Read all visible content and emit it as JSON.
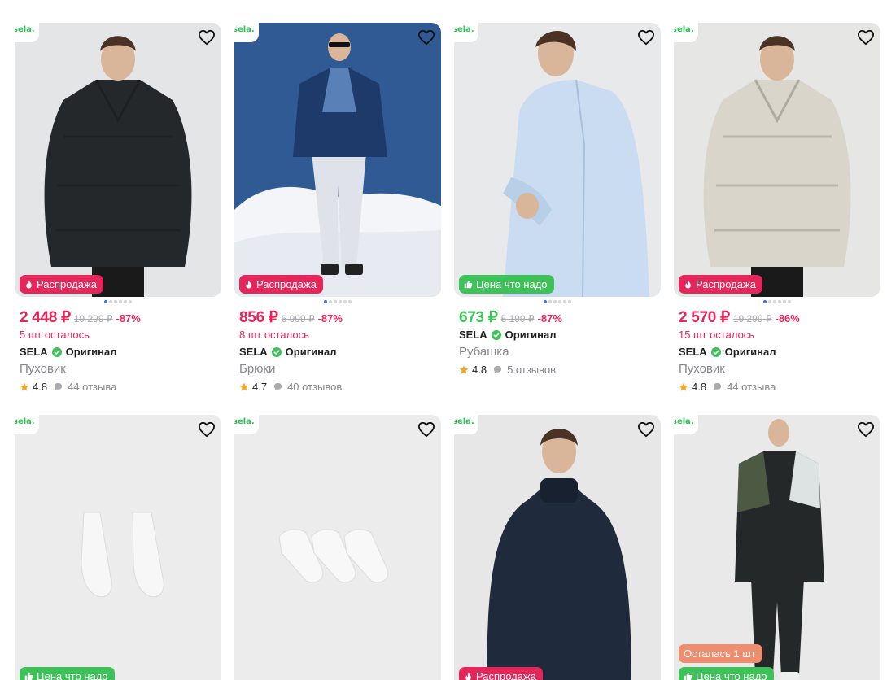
{
  "products": [
    {
      "brand_logo": "sela.",
      "badge": {
        "type": "sale",
        "text": "Распродажа",
        "icon": "flame-icon"
      },
      "price_now": "2 448 ₽",
      "price_old": "19 299 ₽",
      "discount": "-87%",
      "stock": "5 шт осталось",
      "seller": "SELA",
      "verified": "Оригинал",
      "title": "Пуховик",
      "rating": "4.8",
      "reviews": "44 отзыва",
      "photo": {
        "bg": "#e4e5e7",
        "garment": "#25282b",
        "type": "jacket"
      }
    },
    {
      "brand_logo": "sela.",
      "badge": {
        "type": "sale",
        "text": "Распродажа",
        "icon": "flame-icon"
      },
      "price_now": "856 ₽",
      "price_old": "6 999 ₽",
      "discount": "-87%",
      "stock": "8 шт осталось",
      "seller": "SELA",
      "verified": "Оригинал",
      "title": "Брюки",
      "rating": "4.7",
      "reviews": "40 отзывов",
      "photo": {
        "bg": "#2f5a94",
        "garment": "#dfe2e8",
        "type": "snow"
      }
    },
    {
      "brand_logo": "sela.",
      "badge": {
        "type": "price",
        "text": "Цена что надо",
        "icon": "thumbs-up-icon"
      },
      "price_now": "673 ₽",
      "price_old": "5 199 ₽",
      "discount": "-87%",
      "stock": "",
      "seller": "SELA",
      "verified": "Оригинал",
      "title": "Рубашка",
      "rating": "4.8",
      "reviews": "5 отзывов",
      "photo": {
        "bg": "#e8e9eb",
        "garment": "#c9dcf1",
        "type": "shirt"
      }
    },
    {
      "brand_logo": "sela.",
      "badge": {
        "type": "sale",
        "text": "Распродажа",
        "icon": "flame-icon"
      },
      "price_now": "2 570 ₽",
      "price_old": "19 299 ₽",
      "discount": "-86%",
      "stock": "15 шт осталось",
      "seller": "SELA",
      "verified": "Оригинал",
      "title": "Пуховик",
      "rating": "4.8",
      "reviews": "44 отзыва",
      "photo": {
        "bg": "#e6e6e4",
        "garment": "#d9d5cb",
        "type": "jacket"
      }
    },
    {
      "brand_logo": "sela.",
      "badge": {
        "type": "price",
        "text": "Цена что надо",
        "icon": "thumbs-up-icon"
      },
      "photo": {
        "bg": "#ececec",
        "garment": "#f7f7f7",
        "type": "socks2"
      }
    },
    {
      "brand_logo": "sela.",
      "badge": null,
      "photo": {
        "bg": "#ececec",
        "garment": "#f8f8f8",
        "type": "socks3"
      }
    },
    {
      "brand_logo": "sela.",
      "badge": {
        "type": "sale",
        "text": "Распродажа",
        "icon": "flame-icon"
      },
      "photo": {
        "bg": "#e7e7e7",
        "garment": "#1f2a3d",
        "type": "sweater"
      }
    },
    {
      "brand_logo": "sela.",
      "badge": {
        "type": "price",
        "text": "Цена что надо",
        "icon": "thumbs-up-icon"
      },
      "extra_badge": {
        "type": "left",
        "text": "Осталась 1 шт"
      },
      "photo": {
        "bg": "#e9e9e9",
        "garment": "#252829",
        "type": "tracksuit"
      }
    }
  ],
  "colors": {
    "sale": "#e5265a",
    "good_price": "#3fc15a",
    "brand": "#2fbf55",
    "rating_star": "#f5a623"
  }
}
